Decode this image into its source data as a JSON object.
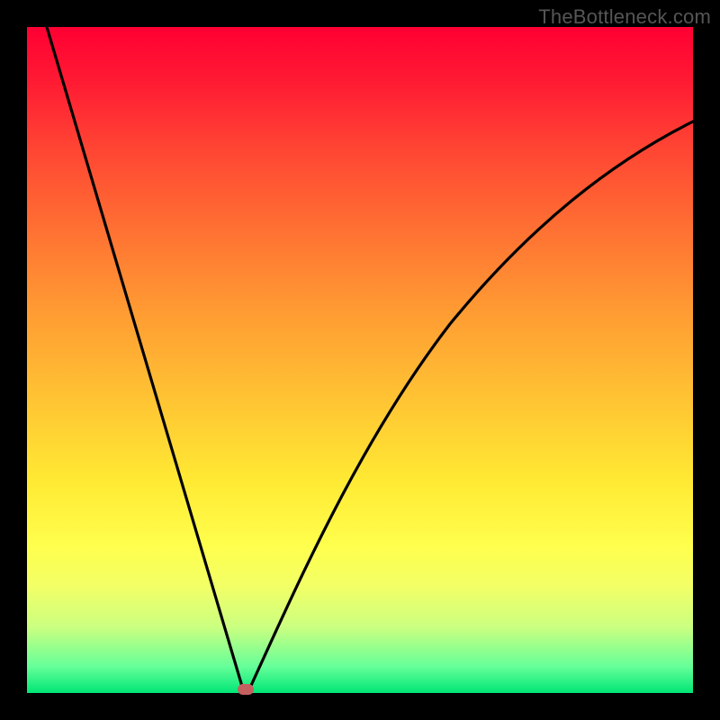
{
  "watermark": "TheBottleneck.com",
  "colors": {
    "frame": "#000000",
    "curve": "#000000",
    "marker": "#c56060",
    "gradient_stops": [
      "#ff0033",
      "#ff9933",
      "#ffff4d",
      "#00e676"
    ]
  },
  "chart_data": {
    "type": "line",
    "title": "",
    "xlabel": "",
    "ylabel": "",
    "xlim": [
      0,
      100
    ],
    "ylim": [
      0,
      100
    ],
    "grid": false,
    "legend": false,
    "note": "Values estimated from pixel positions; y is percentage height from bottom (0) to top (100).",
    "series": [
      {
        "name": "bottleneck-curve",
        "x": [
          3,
          5,
          8,
          10,
          13,
          15,
          18,
          20,
          23,
          25,
          28,
          30,
          31,
          32,
          33,
          34,
          35,
          37,
          40,
          43,
          47,
          50,
          55,
          60,
          65,
          70,
          75,
          80,
          85,
          90,
          95,
          100
        ],
        "y": [
          100,
          93,
          82,
          75,
          64,
          57,
          47,
          40,
          29,
          22,
          11,
          4,
          1,
          0,
          0,
          1,
          3,
          8,
          15,
          22,
          31,
          37,
          46,
          54,
          60,
          66,
          71,
          75,
          78,
          81,
          84,
          86
        ]
      }
    ],
    "marker": {
      "x": 32.5,
      "y": 0.3,
      "shape": "pill",
      "color": "#c56060"
    }
  }
}
